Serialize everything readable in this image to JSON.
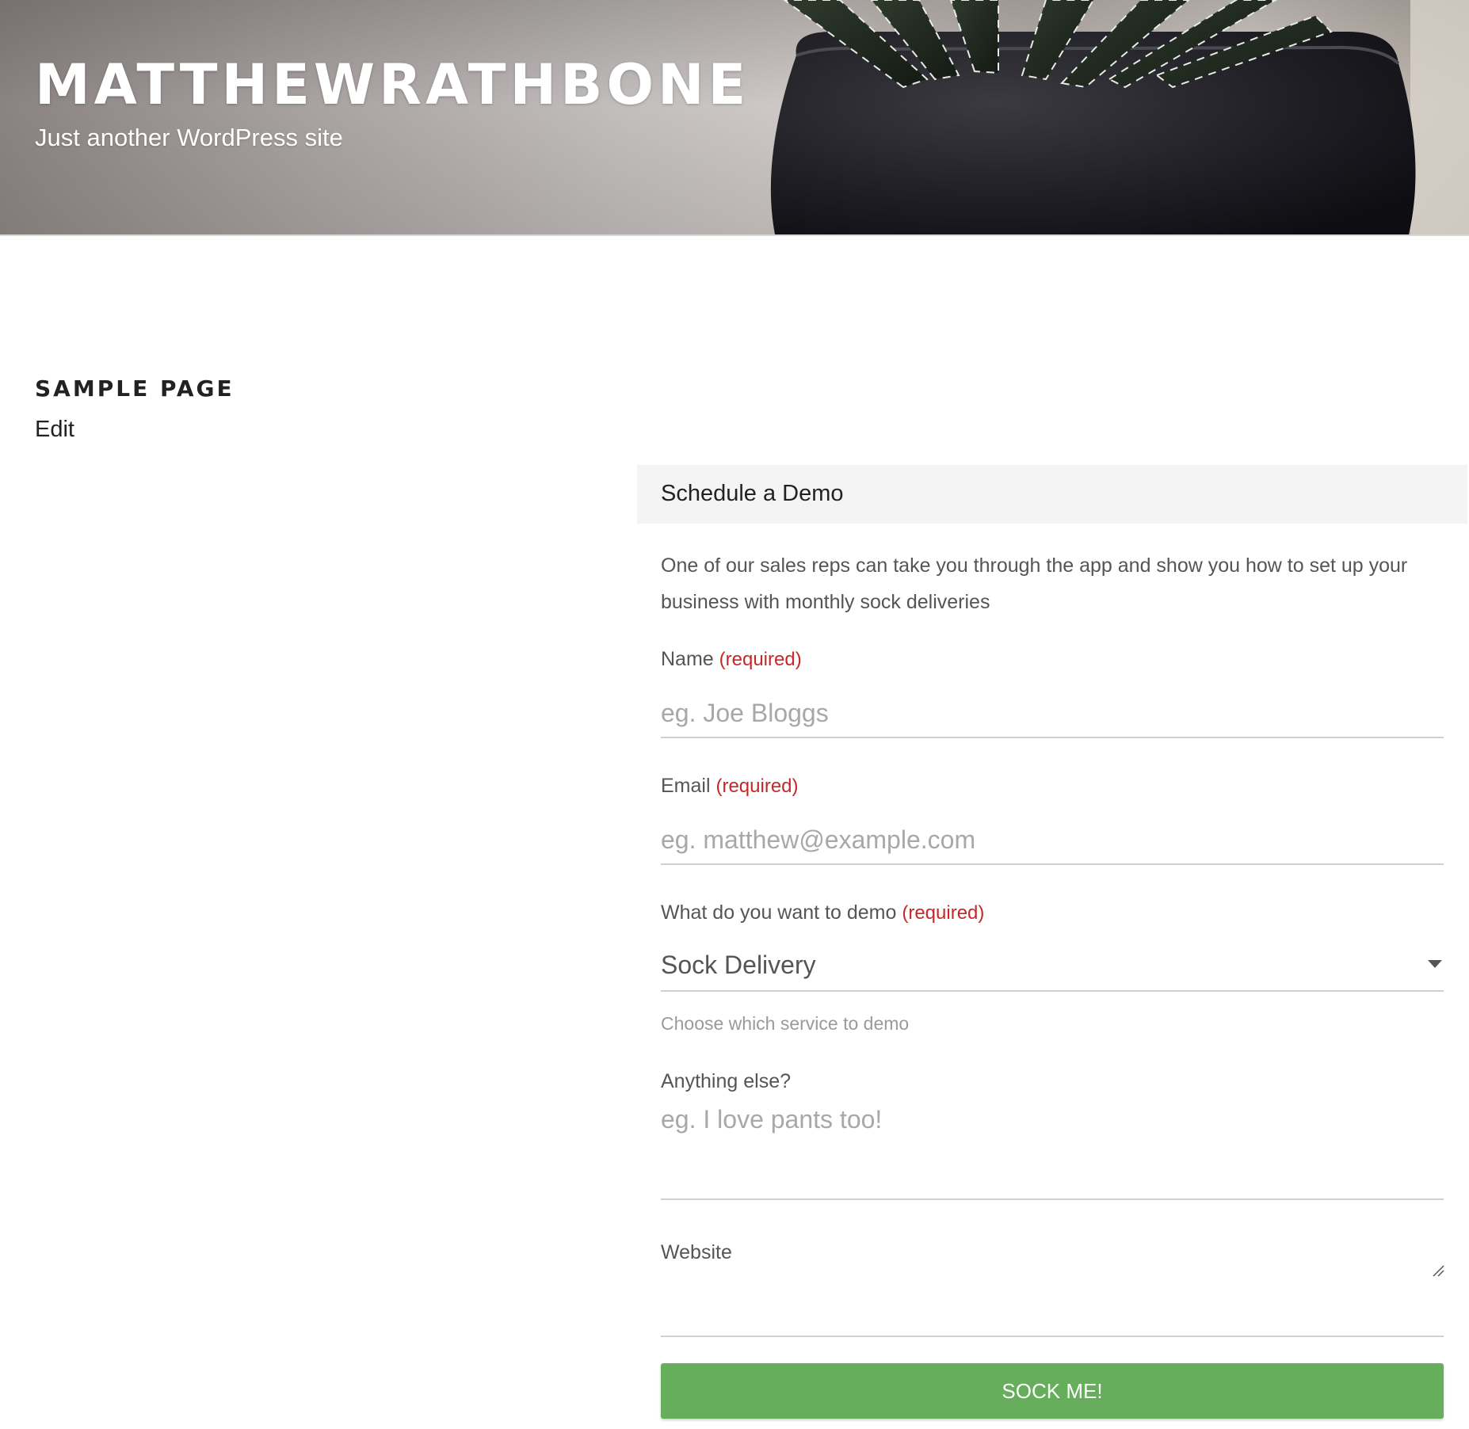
{
  "site": {
    "title": "MATTHEWRATHBONE",
    "tagline": "Just another WordPress site"
  },
  "page": {
    "title": "SAMPLE PAGE",
    "edit_label": "Edit"
  },
  "form": {
    "heading": "Schedule a Demo",
    "intro": "One of our sales reps can take you through the app and show you how to set up your business with monthly sock deliveries",
    "required_marker": "(required)",
    "fields": {
      "name": {
        "label": "Name",
        "placeholder": "eg. Joe Bloggs",
        "value": ""
      },
      "email": {
        "label": "Email",
        "placeholder": "eg. matthew@example.com",
        "value": ""
      },
      "demo": {
        "label": "What do you want to demo",
        "selected": "Sock Delivery",
        "help": "Choose which service to demo"
      },
      "anything_else": {
        "label": "Anything else?",
        "placeholder": "eg. I love pants too!",
        "value": ""
      },
      "website": {
        "label": "Website",
        "placeholder": "",
        "value": ""
      }
    },
    "submit_label": "SOCK ME!"
  },
  "colors": {
    "submit_bg": "#66ad5c",
    "required": "#c62828",
    "header_panel": "#f4f4f4"
  },
  "icons": {
    "select": "caret-down-icon",
    "textarea": "resize-grip-icon"
  }
}
